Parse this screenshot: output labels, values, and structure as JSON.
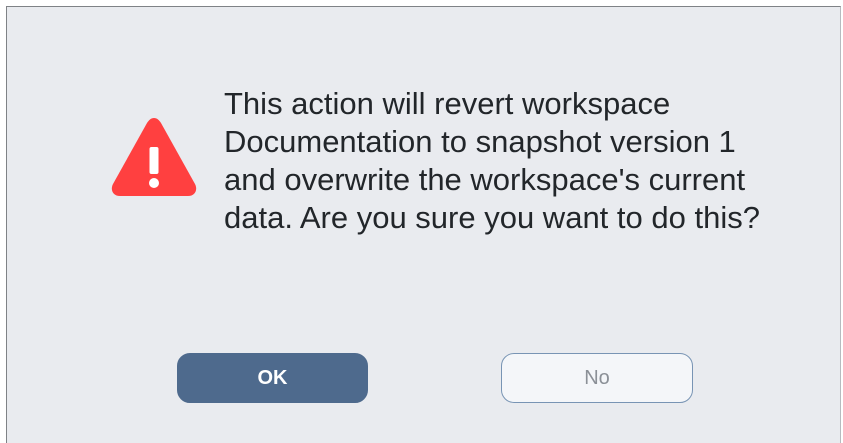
{
  "dialog": {
    "message": "This action will revert workspace Documentation to snapshot version 1 and overwrite the workspace's current data. Are you sure you want to do this?",
    "icon": "warning-icon",
    "ok_label": "OK",
    "no_label": "No"
  },
  "colors": {
    "background": "#e9ebef",
    "warning_red": "#ff4040",
    "ok_button": "#4e6a8d",
    "no_button_border": "#7894b4",
    "text": "#22262a"
  }
}
